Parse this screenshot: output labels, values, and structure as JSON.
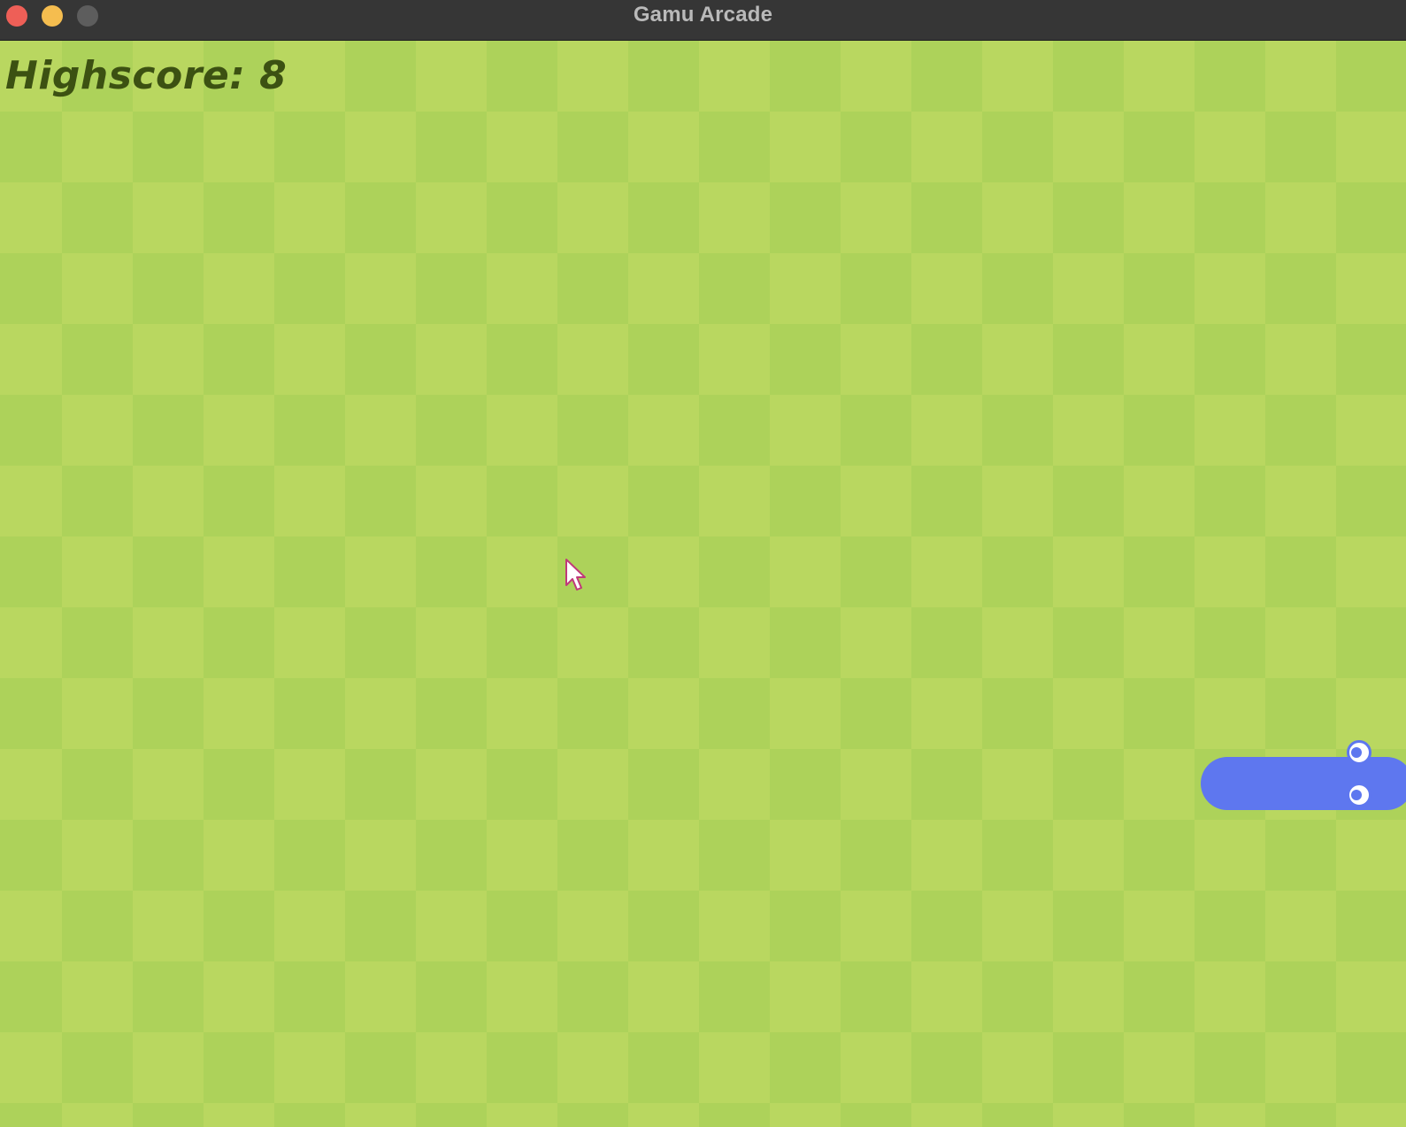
{
  "window": {
    "title": "Gamu Arcade",
    "buttons": [
      "close",
      "minimize",
      "zoom"
    ],
    "colors": {
      "titlebar": "#363636",
      "close": "#ee5f57",
      "minimize": "#f5bd4f",
      "zoom": "#5d5d5d"
    }
  },
  "game": {
    "highscore_text": "Highscore: 8",
    "highscore": 8,
    "board_colors": {
      "light": "#b9d760",
      "dark": "#add25a"
    },
    "snake": {
      "color": "#5e77ef",
      "direction": "right"
    }
  },
  "pointer": {
    "icon": "arrow-cursor-icon"
  }
}
